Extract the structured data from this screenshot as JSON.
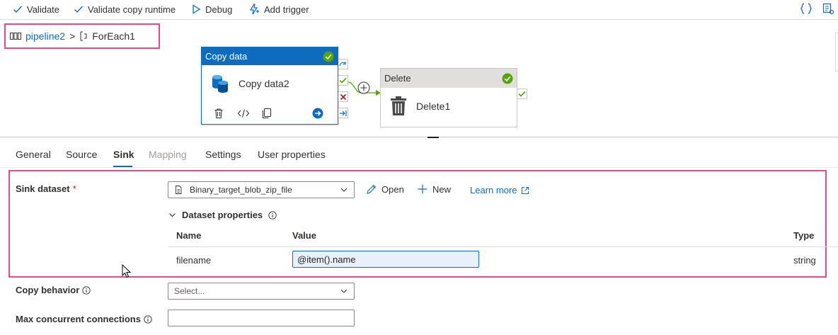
{
  "toolbar": {
    "validate": "Validate",
    "validate_copy_runtime": "Validate copy runtime",
    "debug": "Debug",
    "add_trigger": "Add trigger"
  },
  "breadcrumb": {
    "pipeline": "pipeline2",
    "separator": ">",
    "current": "ForEach1"
  },
  "canvas": {
    "copy_activity": {
      "type_label": "Copy data",
      "name": "Copy data2",
      "status": "succeeded"
    },
    "delete_activity": {
      "type_label": "Delete",
      "name": "Delete1",
      "status": "succeeded"
    }
  },
  "tabs": [
    {
      "label": "General",
      "state": "normal"
    },
    {
      "label": "Source",
      "state": "normal"
    },
    {
      "label": "Sink",
      "state": "active"
    },
    {
      "label": "Mapping",
      "state": "disabled"
    },
    {
      "label": "Settings",
      "state": "normal"
    },
    {
      "label": "User properties",
      "state": "normal"
    }
  ],
  "sink": {
    "dataset_label": "Sink dataset",
    "required_mark": "*",
    "dataset_value": "Binary_target_blob_zip_file",
    "open_label": "Open",
    "new_label": "New",
    "learn_more_label": "Learn more",
    "dataset_properties_label": "Dataset properties",
    "table": {
      "headers": {
        "name": "Name",
        "value": "Value",
        "type": "Type"
      },
      "rows": [
        {
          "name": "filename",
          "value": "@item().name",
          "type": "string"
        }
      ]
    },
    "copy_behavior_label": "Copy behavior",
    "copy_behavior_placeholder": "Select...",
    "max_connections_label": "Max concurrent connections"
  },
  "colors": {
    "accent": "#0f6cbd",
    "highlight": "#e8478b",
    "success": "#57a300",
    "fail": "#a4262c"
  }
}
